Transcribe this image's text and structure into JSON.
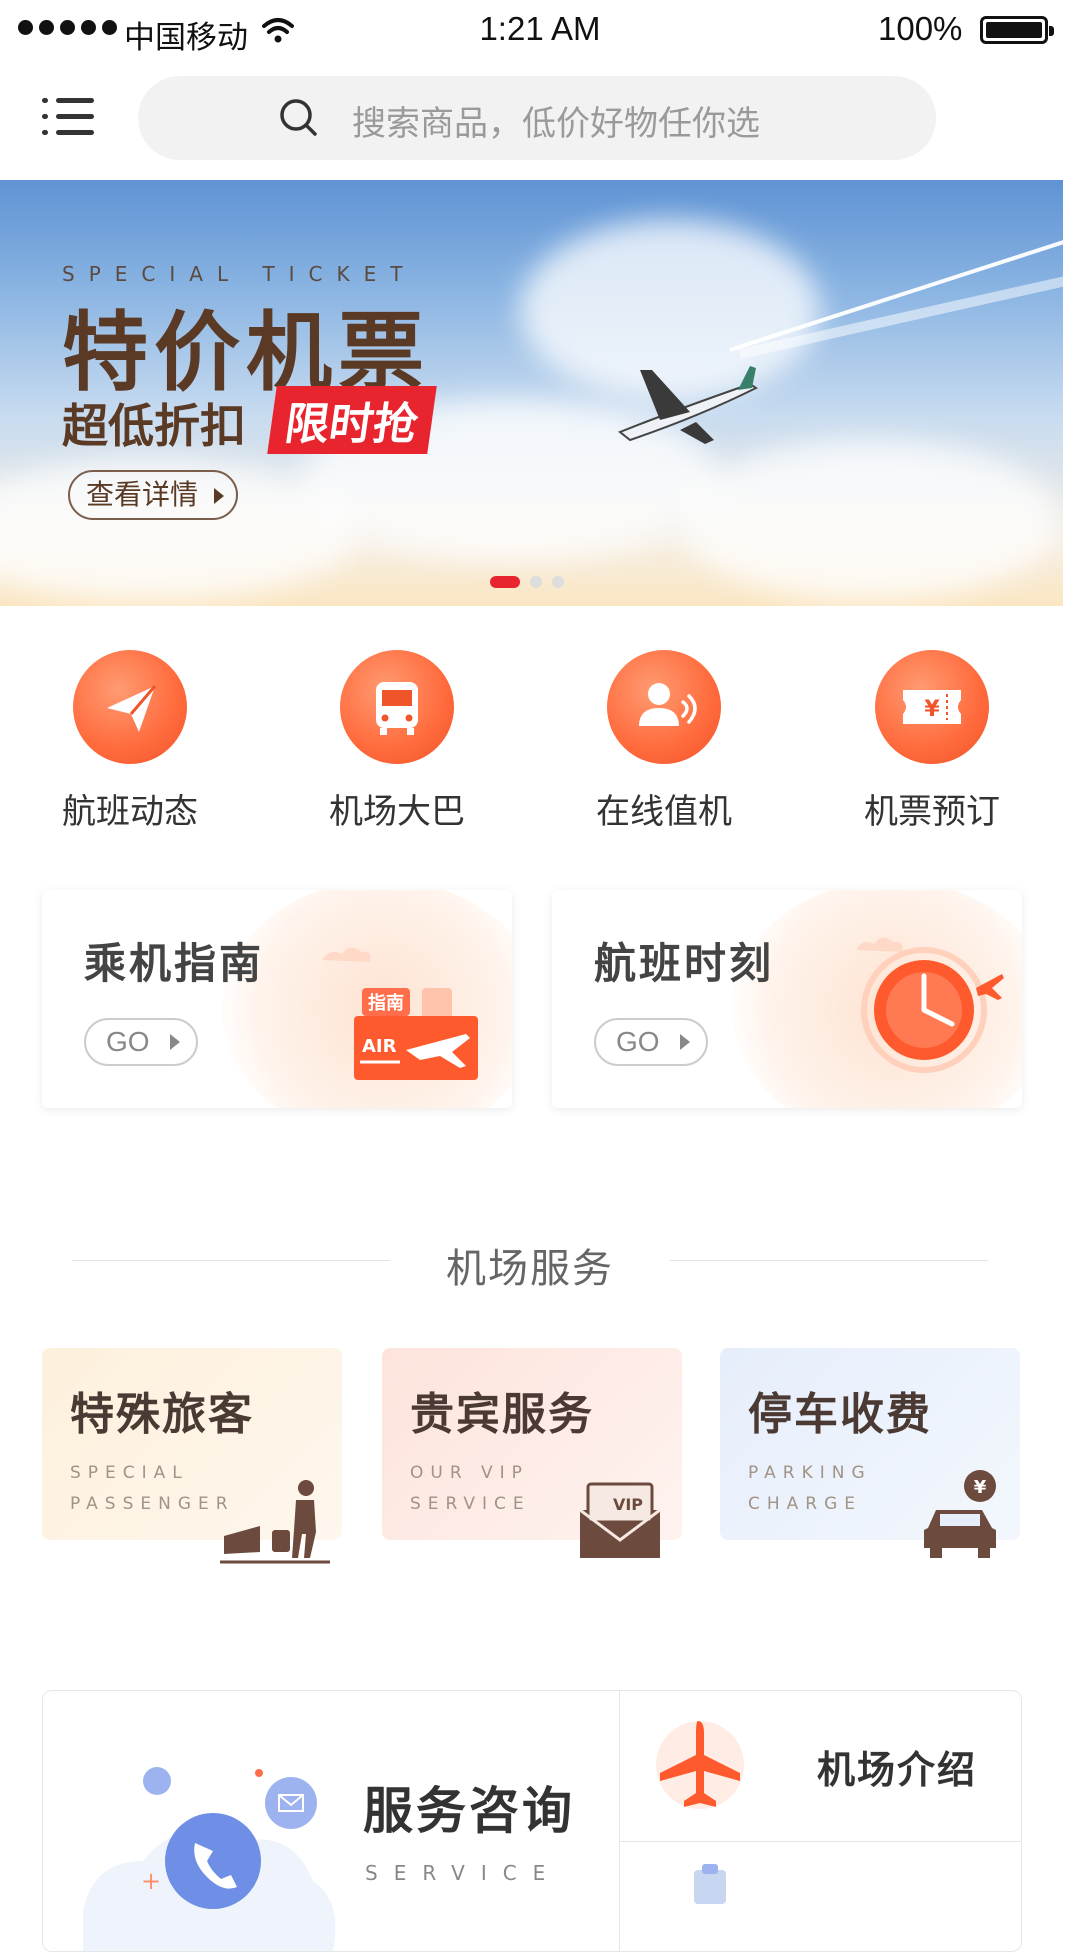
{
  "status_bar": {
    "carrier": "中国移动",
    "time": "1:21 AM",
    "battery": "100%"
  },
  "header": {
    "search_placeholder": "搜索商品，低价好物任你选"
  },
  "banner": {
    "subtitle": "SPECIAL TICKET",
    "title": "特价机票",
    "line2": "超低折扣",
    "hot_tag": "限时抢",
    "button": "查看详情",
    "pager": {
      "count": 3,
      "active": 1
    }
  },
  "quick_actions": [
    {
      "label": "航班动态",
      "icon": "paper-plane-icon"
    },
    {
      "label": "机场大巴",
      "icon": "bus-icon"
    },
    {
      "label": "在线值机",
      "icon": "user-checkin-icon"
    },
    {
      "label": "机票预订",
      "icon": "ticket-icon"
    }
  ],
  "guide_cards": [
    {
      "title": "乘机指南",
      "button": "GO",
      "badge_top": "指南",
      "badge_bottom": "AIR"
    },
    {
      "title": "航班时刻",
      "button": "GO"
    }
  ],
  "section": {
    "title": "机场服务"
  },
  "services": [
    {
      "title": "特殊旅客",
      "sub1": "SPECIAL",
      "sub2": "PASSENGER",
      "icon": "traveler-luggage-icon",
      "color": "#fdf0dc"
    },
    {
      "title": "贵宾服务",
      "sub1": "OUR VIP",
      "sub2": "SERVICE",
      "icon": "vip-envelope-icon",
      "vip_label": "VIP",
      "color": "#fde3dc"
    },
    {
      "title": "停车收费",
      "sub1": "PARKING",
      "sub2": "CHARGE",
      "icon": "car-yen-icon",
      "yen": "¥",
      "color": "#e6eefb"
    }
  ],
  "bottom_panel": {
    "consult_title": "服务咨询",
    "consult_sub": "SERVICE",
    "intro_label": "机场介绍"
  }
}
